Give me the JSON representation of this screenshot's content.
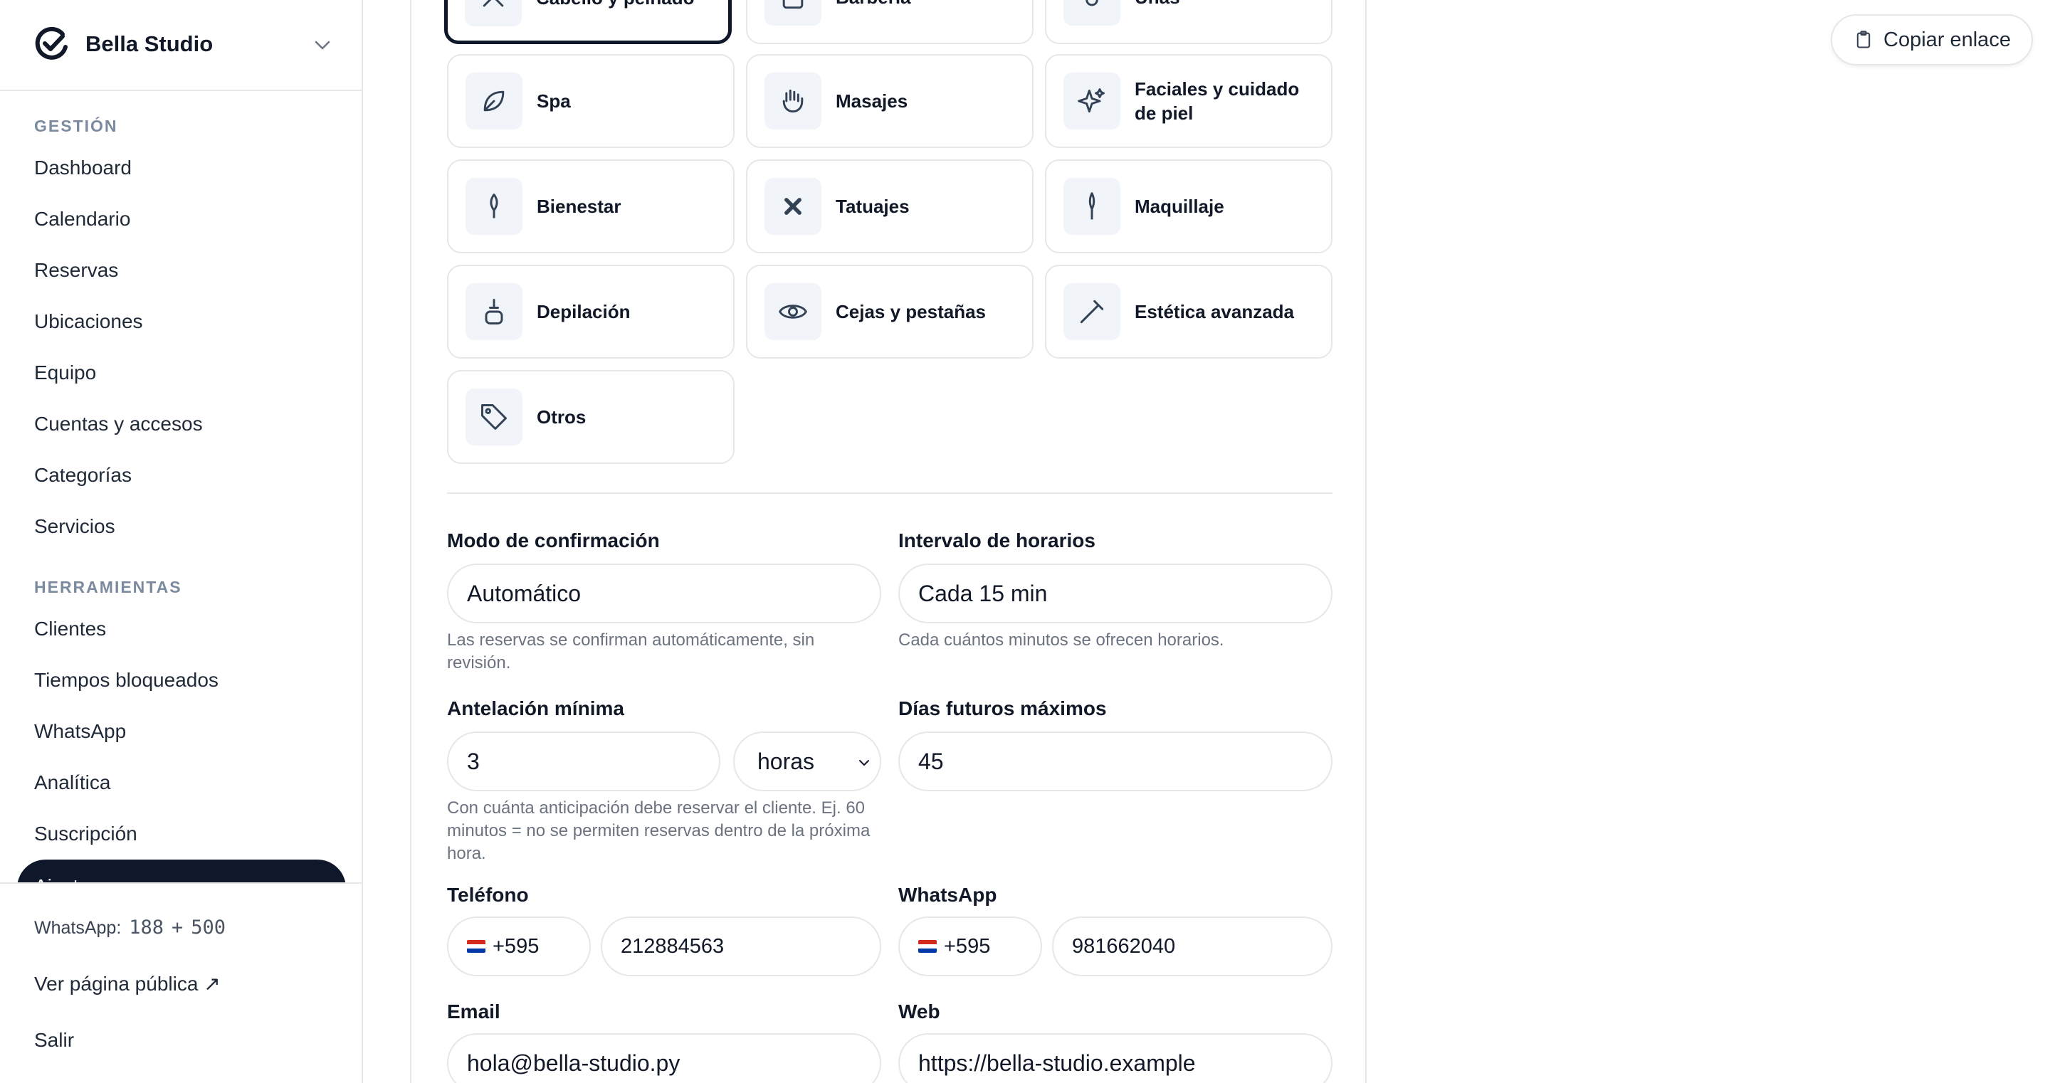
{
  "brand": {
    "name": "Bella Studio"
  },
  "nav": {
    "section_gestion": "GESTIÓN",
    "gestion_items": [
      "Dashboard",
      "Calendario",
      "Reservas",
      "Ubicaciones",
      "Equipo",
      "Cuentas y accesos",
      "Categorías",
      "Servicios"
    ],
    "section_herramientas": "HERRAMIENTAS",
    "herramientas_items": [
      "Clientes",
      "Tiempos bloqueados",
      "WhatsApp",
      "Analítica",
      "Suscripción",
      "Ajustes"
    ]
  },
  "footer": {
    "wa_label": "WhatsApp:",
    "wa_used": "188",
    "wa_plus": "+",
    "wa_total": "500",
    "public_page": "Ver página pública ↗",
    "logout": "Salir"
  },
  "categories": [
    {
      "label": "Cabello y peinado",
      "icon": "scissors-icon",
      "selected": true
    },
    {
      "label": "Barbería",
      "icon": "barber-icon"
    },
    {
      "label": "Uñas",
      "icon": "nail-icon"
    },
    {
      "label": "Spa",
      "icon": "leaf-icon"
    },
    {
      "label": "Masajes",
      "icon": "hand-icon"
    },
    {
      "label": "Faciales y cuidado de piel",
      "icon": "sparkles-icon"
    },
    {
      "label": "Bienestar",
      "icon": "lotus-icon"
    },
    {
      "label": "Tatuajes",
      "icon": "tattoo-x-icon"
    },
    {
      "label": "Maquillaje",
      "icon": "brush-icon"
    },
    {
      "label": "Depilación",
      "icon": "wax-icon"
    },
    {
      "label": "Cejas y pestañas",
      "icon": "eye-icon"
    },
    {
      "label": "Estética avanzada",
      "icon": "wand-icon"
    },
    {
      "label": "Otros",
      "icon": "tag-icon"
    }
  ],
  "form": {
    "confirm_mode": {
      "label": "Modo de confirmación",
      "value": "Automático",
      "help": "Las reservas se confirman automáticamente, sin revisión."
    },
    "slot_interval": {
      "label": "Intervalo de horarios",
      "value": "Cada 15 min",
      "help": "Cada cuántos minutos se ofrecen horarios."
    },
    "min_notice": {
      "label": "Antelación mínima",
      "value": "3",
      "unit": "horas",
      "help": "Con cuánta anticipación debe reservar el cliente. Ej. 60 minutos = no se permiten reservas dentro de la próxima hora."
    },
    "max_days": {
      "label": "Días futuros máximos",
      "value": "45"
    },
    "phone": {
      "label": "Teléfono",
      "country_code": "+595",
      "number": "212884563"
    },
    "whatsapp": {
      "label": "WhatsApp",
      "country_code": "+595",
      "number": "981662040"
    },
    "email": {
      "label": "Email",
      "value": "hola@bella-studio.py"
    },
    "web": {
      "label": "Web",
      "value": "https://bella-studio.example"
    }
  },
  "header": {
    "copy_link": "Copiar enlace"
  }
}
